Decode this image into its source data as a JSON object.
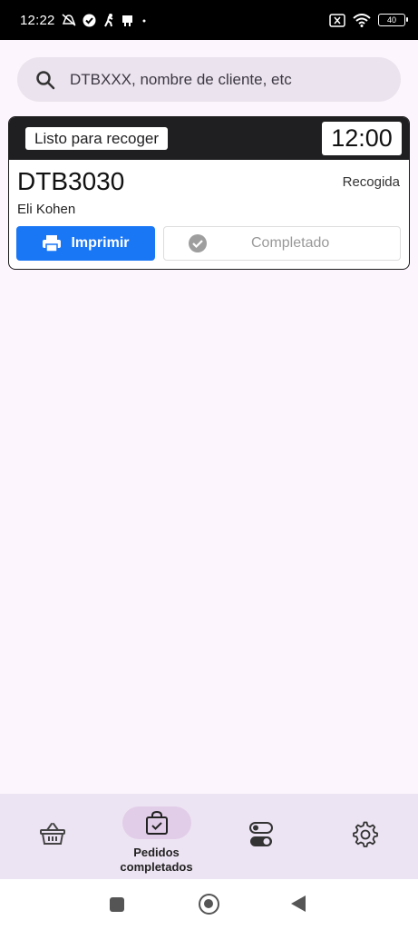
{
  "status_bar": {
    "time": "12:22",
    "battery": "40"
  },
  "search": {
    "placeholder": "DTBXXX, nombre de cliente, etc"
  },
  "order": {
    "status": "Listo para recoger",
    "time": "12:00",
    "id": "DTB3030",
    "type": "Recogida",
    "customer": "Eli Kohen",
    "print_label": "Imprimir",
    "complete_label": "Completado"
  },
  "bottom_nav": {
    "active_label": "Pedidos completados",
    "items": [
      "basket-icon",
      "bag-check-icon",
      "toggle-icon",
      "gear-icon"
    ]
  },
  "colors": {
    "primary_button": "#1976f5",
    "card_header": "#1f1f21",
    "background": "#fdf5fd",
    "nav_background": "#ede4f3",
    "nav_active_pill": "#e2cde8"
  }
}
